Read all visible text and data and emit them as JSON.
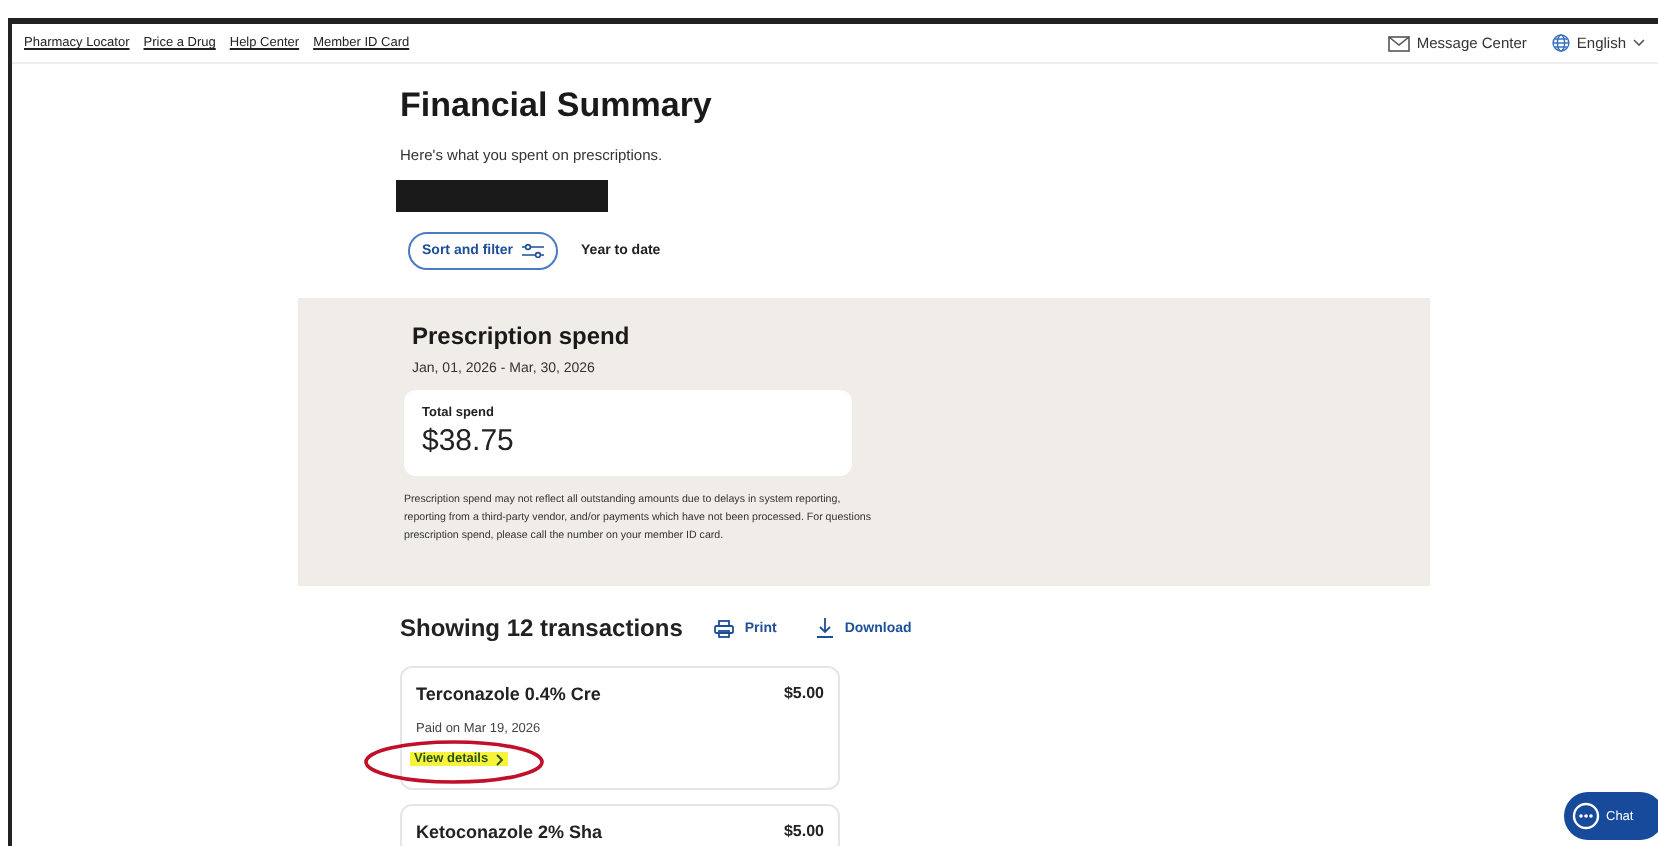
{
  "top_links": [
    "Pharmacy Locator",
    "Price a Drug",
    "Help Center",
    "Member ID Card"
  ],
  "top_right": {
    "message_center": "Message Center",
    "language": "English"
  },
  "header": {
    "title": "Financial Summary",
    "subtitle": "Here's what you spent on prescriptions.",
    "sort_button": "Sort and filter",
    "period": "Year to date"
  },
  "spend": {
    "title": "Prescription spend",
    "date_range": "Jan, 01, 2026 - Mar, 30, 2026",
    "total_label": "Total spend",
    "total": "$38.75",
    "disclaimer": "Prescription spend may not reflect all outstanding amounts due to delays in system reporting, reporting from a third-party vendor, and/or payments which have not been processed. For questions prescription spend, please call the number on your member ID card."
  },
  "transactions": {
    "heading": "Showing 12 transactions",
    "print": "Print",
    "download": "Download",
    "items": [
      {
        "name": "Terconazole 0.4% Cre",
        "amount": "$5.00",
        "paid": "Paid on Mar 19, 2026",
        "link": "View details",
        "highlighted": true
      },
      {
        "name": "Ketoconazole 2% Sha",
        "amount": "$5.00"
      }
    ]
  },
  "chat": "Chat"
}
